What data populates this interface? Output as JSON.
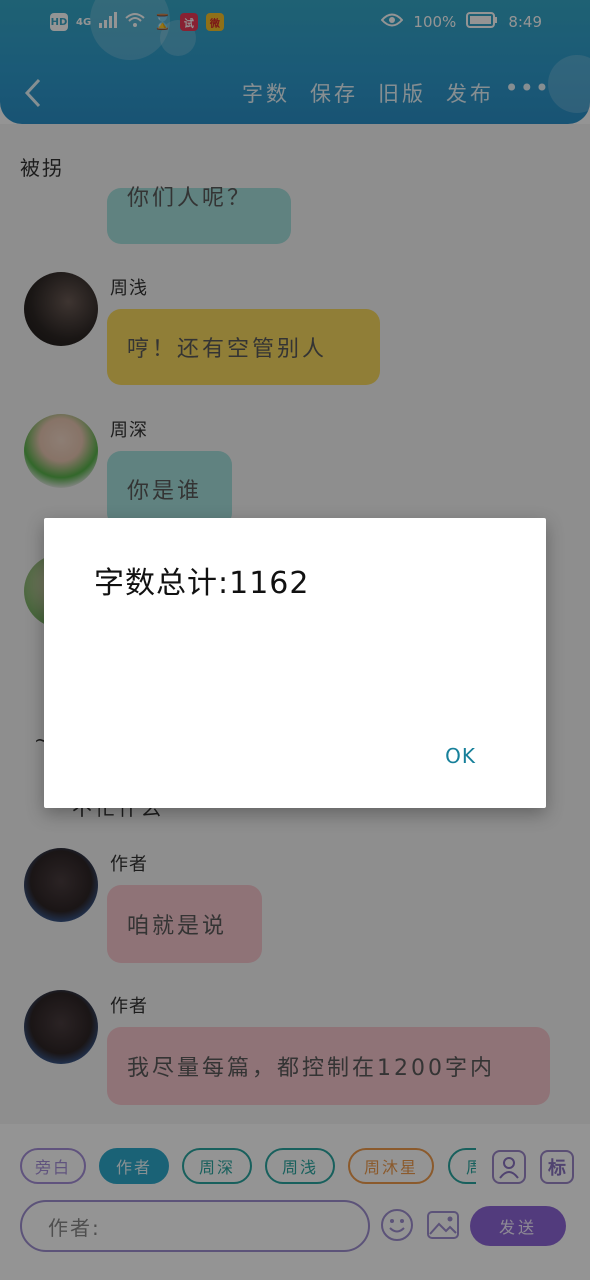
{
  "status_bar": {
    "hd": "HD",
    "network": "4G",
    "battery_text": "100%",
    "time": "8:49",
    "app1_label": "试",
    "app2_label": "微"
  },
  "toolbar": {
    "items": [
      "字数",
      "保存",
      "旧版",
      "发布"
    ],
    "more": "•••"
  },
  "chat": {
    "title": "被拐",
    "messages": [
      {
        "name": "",
        "text": "你们人呢？",
        "bubble_color": "#a5e0dc"
      },
      {
        "name": "周浅",
        "text": "哼！还有空管别人",
        "bubble_color": "#f8d95f"
      },
      {
        "name": "周深",
        "text": "你是谁",
        "bubble_color": "#a5e0dc"
      },
      {
        "name": "作者",
        "text": "咱就是说",
        "bubble_color": "#f7c6ce"
      },
      {
        "name": "作者",
        "text": "我尽量每篇，都控制在1200字内",
        "bubble_color": "#f7c6ce"
      }
    ],
    "partial_text_left": "~",
    "partial_text_bottom": "不忙什么"
  },
  "dialog": {
    "message": "字数总计:1162",
    "ok_label": "OK"
  },
  "bottom": {
    "roles": [
      {
        "label": "旁白",
        "color": "#a58fd9"
      },
      {
        "label": "作者",
        "color": "#2eaacc"
      },
      {
        "label": "周深",
        "color": "#2aa6a0"
      },
      {
        "label": "周浅",
        "color": "#2aa6a0"
      },
      {
        "label": "周沐星",
        "color": "#ef9b4c"
      },
      {
        "label": "周",
        "color": "#2aa6a0"
      }
    ],
    "contacts_icon": "person-icon",
    "tag_label": "标",
    "input_placeholder": "作者:",
    "send_label": "发送"
  }
}
